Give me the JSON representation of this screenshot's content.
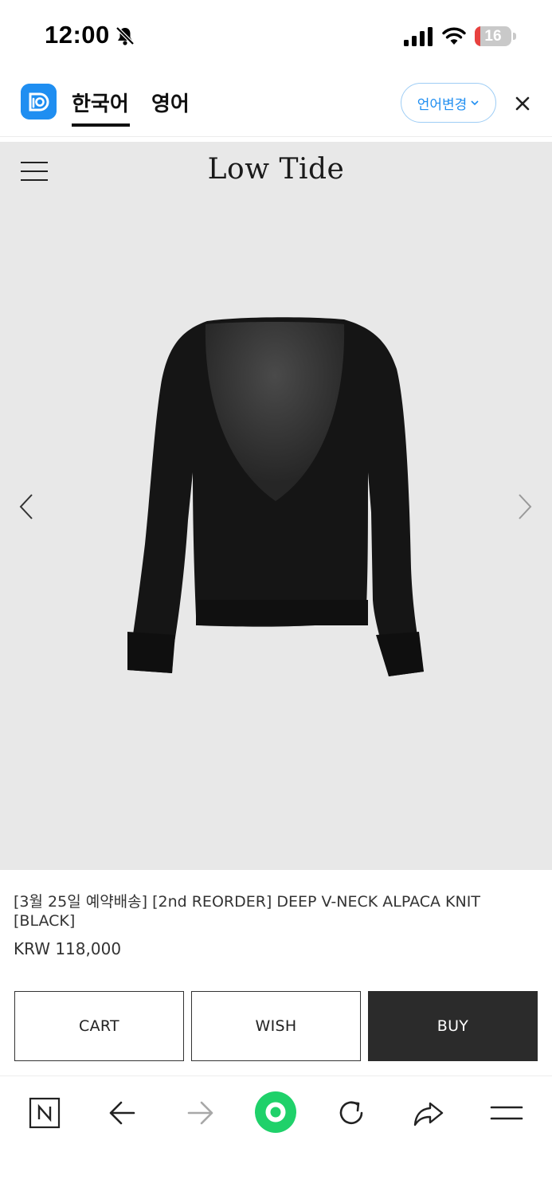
{
  "status_bar": {
    "time": "12:00",
    "battery_level": "16",
    "battery_fraction": 0.16,
    "icons": [
      "bell-slash-icon",
      "cellular-signal-icon",
      "wifi-icon",
      "battery-icon"
    ]
  },
  "translate_bar": {
    "tabs": [
      {
        "label": "한국어",
        "active": true
      },
      {
        "label": "영어",
        "active": false
      }
    ],
    "change_language_label": "언어변경",
    "accent_color": "#1f8ef1"
  },
  "store": {
    "brand": "Low Tide"
  },
  "product": {
    "title": "[3월 25일 예약배송] [2nd REORDER] DEEP V-NECK ALPACA KNIT [BLACK]",
    "price": "KRW 118,000"
  },
  "actions": {
    "cart_label": "CART",
    "wish_label": "WISH",
    "buy_label": "BUY"
  },
  "browser_toolbar": {
    "icons": [
      "naver-n-icon",
      "back-arrow-icon",
      "forward-arrow-icon",
      "green-home-icon",
      "reload-icon",
      "share-icon",
      "menu-icon"
    ],
    "accent_color": "#1fd16a"
  }
}
